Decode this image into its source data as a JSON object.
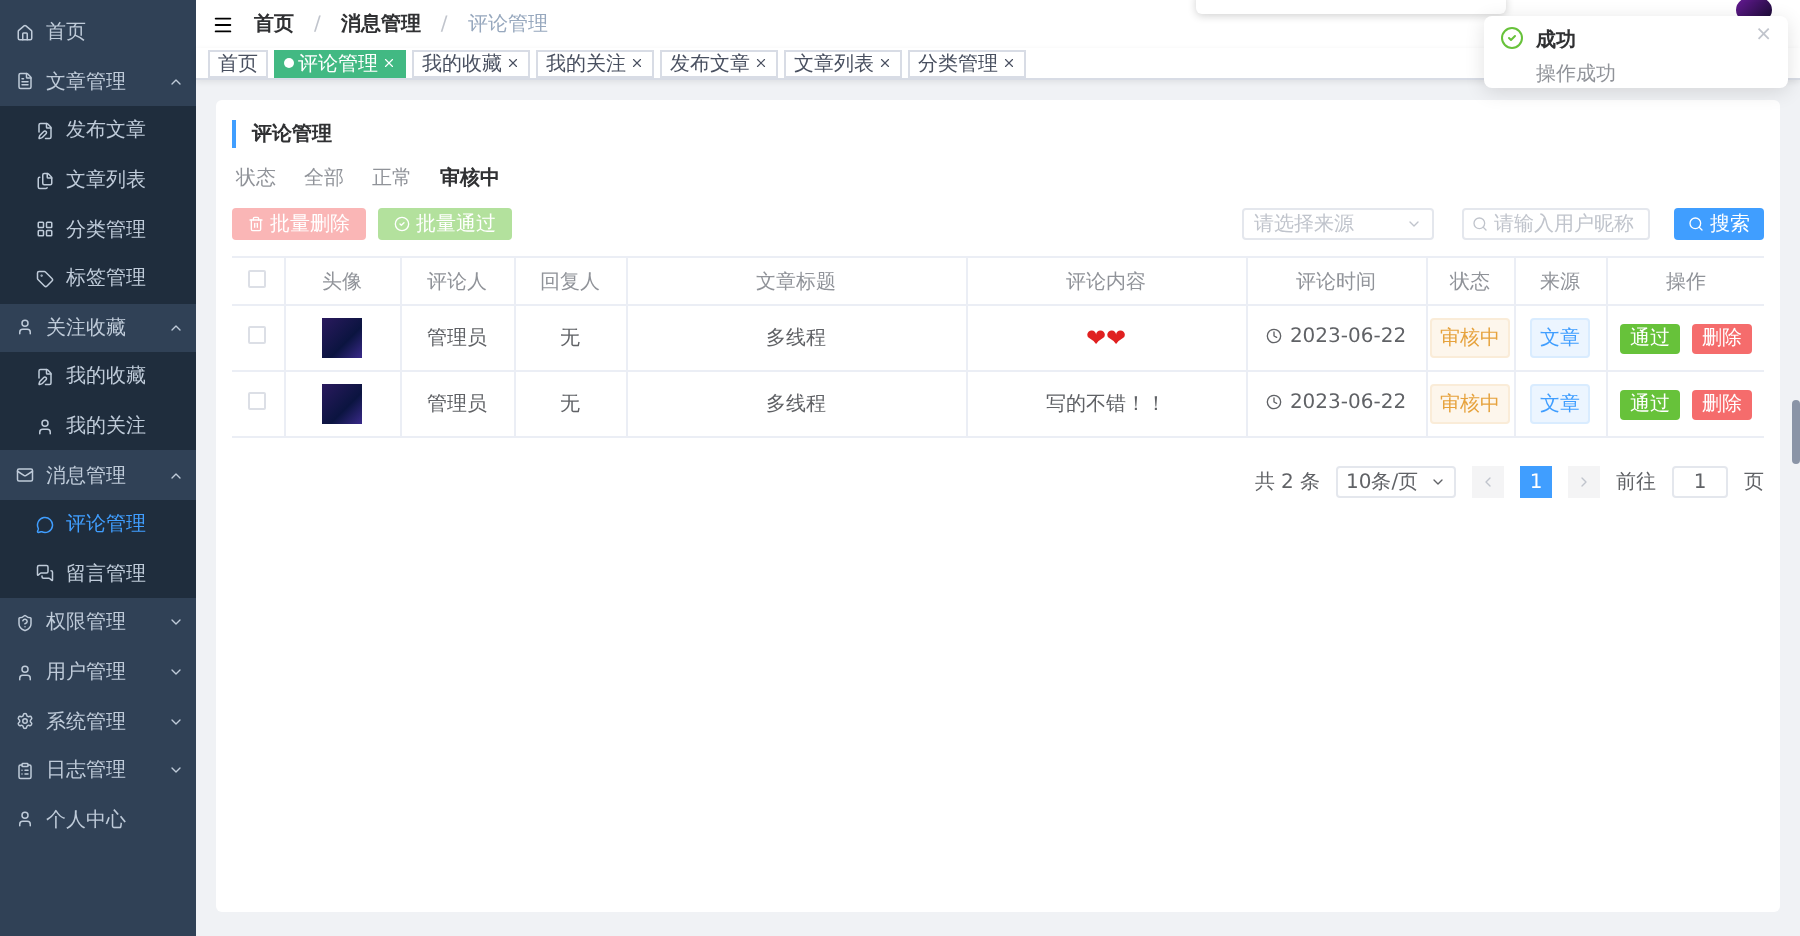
{
  "sidebar": {
    "items": [
      {
        "label": "首页",
        "selected": false
      },
      {
        "label": "文章管理",
        "expanded": true,
        "children": [
          {
            "label": "发布文章",
            "selected": false
          },
          {
            "label": "文章列表",
            "selected": false
          },
          {
            "label": "分类管理",
            "selected": false
          },
          {
            "label": "标签管理",
            "selected": false
          }
        ]
      },
      {
        "label": "关注收藏",
        "expanded": true,
        "children": [
          {
            "label": "我的收藏",
            "selected": false
          },
          {
            "label": "我的关注",
            "selected": false
          }
        ]
      },
      {
        "label": "消息管理",
        "expanded": true,
        "children": [
          {
            "label": "评论管理",
            "selected": true
          },
          {
            "label": "留言管理",
            "selected": false
          }
        ]
      },
      {
        "label": "权限管理",
        "expanded": false
      },
      {
        "label": "用户管理",
        "expanded": false
      },
      {
        "label": "系统管理",
        "expanded": false
      },
      {
        "label": "日志管理",
        "expanded": false
      },
      {
        "label": "个人中心",
        "selected": false
      }
    ]
  },
  "breadcrumb": [
    "首页",
    "消息管理",
    "评论管理"
  ],
  "breadcrumb_separator": "/",
  "tabs": [
    {
      "label": "首页",
      "selected": false,
      "closable": false
    },
    {
      "label": "评论管理",
      "selected": true,
      "closable": true
    },
    {
      "label": "我的收藏",
      "selected": false,
      "closable": true
    },
    {
      "label": "我的关注",
      "selected": false,
      "closable": true
    },
    {
      "label": "发布文章",
      "selected": false,
      "closable": true
    },
    {
      "label": "文章列表",
      "selected": false,
      "closable": true
    },
    {
      "label": "分类管理",
      "selected": false,
      "closable": true
    }
  ],
  "notification": {
    "title": "成功",
    "message": "操作成功",
    "close": "×"
  },
  "card": {
    "title": "评论管理",
    "filter": {
      "label": "状态",
      "options": [
        {
          "label": "全部",
          "selected": false
        },
        {
          "label": "正常",
          "selected": false
        },
        {
          "label": "审核中",
          "selected": true
        }
      ]
    },
    "actions": [
      {
        "label": "批量删除",
        "kind": "danger",
        "disabled": true
      },
      {
        "label": "批量通过",
        "kind": "success",
        "disabled": true
      }
    ],
    "source_select": {
      "placeholder": "请选择来源"
    },
    "search": {
      "placeholder": "请输入用户昵称"
    },
    "search_button": "搜索",
    "table": {
      "all_checked": false,
      "columns": [
        "头像",
        "评论人",
        "回复人",
        "文章标题",
        "评论内容",
        "评论时间",
        "状态",
        "来源",
        "操作"
      ],
      "rows": [
        {
          "checked": false,
          "commenter": "管理员",
          "reply_to": "无",
          "article": "多线程",
          "content": "❤❤",
          "time": "2023-06-22",
          "status": "审核中",
          "source": "文章",
          "buttons": [
            "通过",
            "删除"
          ]
        },
        {
          "checked": false,
          "commenter": "管理员",
          "reply_to": "无",
          "article": "多线程",
          "content": "写的不错！！",
          "time": "2023-06-22",
          "status": "审核中",
          "source": "文章",
          "buttons": [
            "通过",
            "删除"
          ]
        }
      ]
    },
    "pagination": {
      "total": "共 2 条",
      "page_size": "10条/页",
      "pages": [
        {
          "label": "1",
          "selected": true
        }
      ],
      "goto_label": "前往",
      "goto_value": "1",
      "goto_suffix": "页"
    }
  }
}
